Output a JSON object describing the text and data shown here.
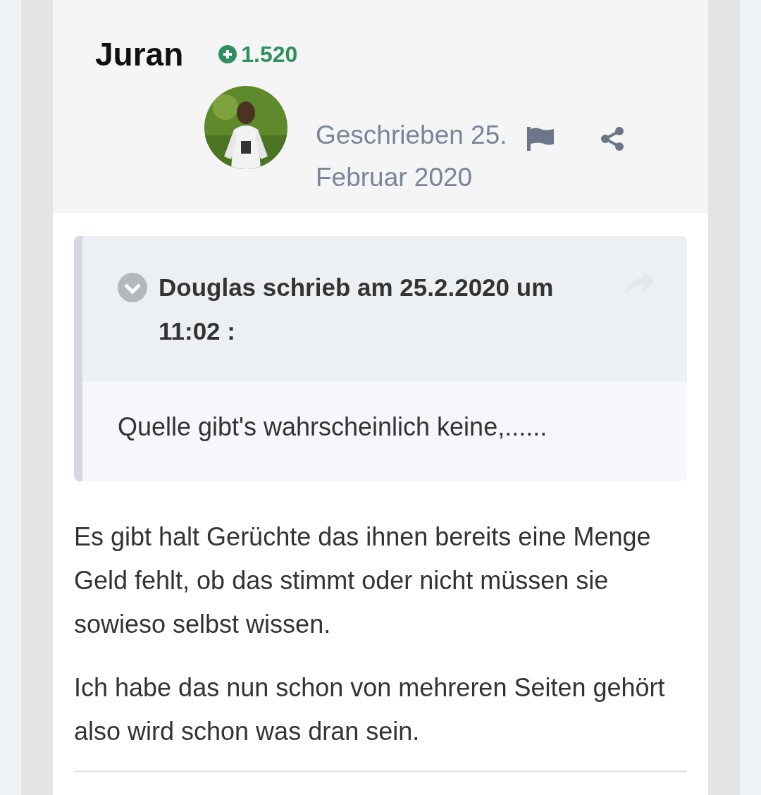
{
  "author": {
    "name": "Juran",
    "reputation": "1.520"
  },
  "post": {
    "date": "Geschrieben 25. Februar 2020"
  },
  "quote": {
    "header": "Douglas schrieb am 25.2.2020 um 11:02 :",
    "text": "Quelle gibt's wahrscheinlich keine,......"
  },
  "paragraphs": [
    "Es gibt halt Gerüchte das ihnen bereits eine Menge Geld fehlt, ob das stimmt oder nicht müssen sie sowieso selbst wissen.",
    "Ich habe das nun schon von mehreren Seiten gehört also wird schon was dran sein."
  ]
}
